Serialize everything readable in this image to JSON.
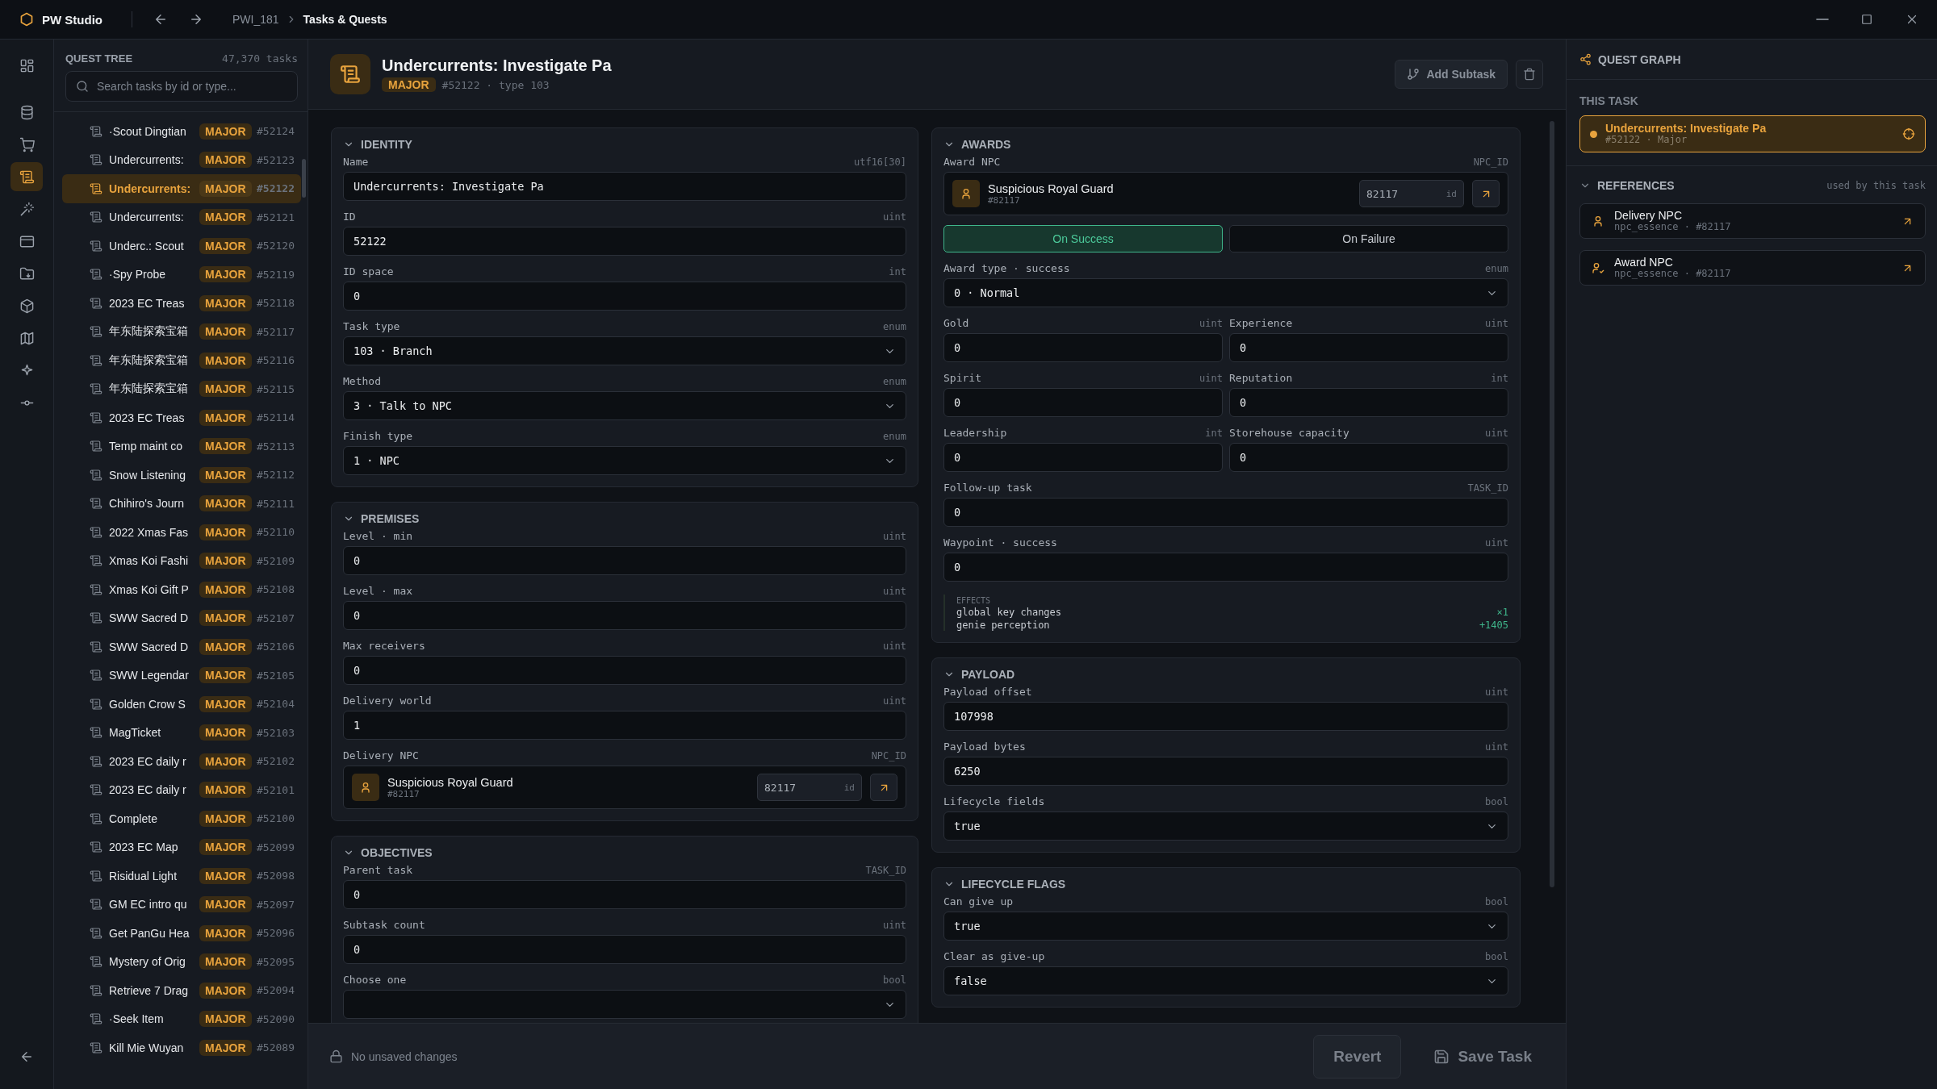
{
  "titlebar": {
    "app": "PW Studio",
    "breadcrumb": [
      "PWI_181",
      "Tasks & Quests"
    ]
  },
  "rail": {
    "items": [
      {
        "selected": false
      },
      {
        "selected": false
      },
      {
        "selected": false
      },
      {
        "selected": true
      },
      {
        "selected": false
      },
      {
        "selected": false
      },
      {
        "selected": false
      },
      {
        "selected": false
      },
      {
        "selected": false
      },
      {
        "selected": false
      },
      {
        "selected": false
      }
    ]
  },
  "tree": {
    "title": "QUEST TREE",
    "count": "47,370 tasks",
    "search": {
      "placeholder": "Search tasks by id or type..."
    },
    "rows": [
      {
        "name": "·Scout Dingtian",
        "badge": "MAJOR",
        "id": "#52124",
        "selected": false
      },
      {
        "name": "Undercurrents:",
        "badge": "MAJOR",
        "id": "#52123",
        "selected": false
      },
      {
        "name": "Undercurrents:",
        "badge": "MAJOR",
        "id": "#52122",
        "selected": true
      },
      {
        "name": "Undercurrents:",
        "badge": "MAJOR",
        "id": "#52121",
        "selected": false
      },
      {
        "name": "Underc.: Scout",
        "badge": "MAJOR",
        "id": "#52120",
        "selected": false
      },
      {
        "name": "·Spy Probe",
        "badge": "MAJOR",
        "id": "#52119",
        "selected": false
      },
      {
        "name": "2023 EC Treas",
        "badge": "MAJOR",
        "id": "#52118",
        "selected": false
      },
      {
        "name": "年东陆探索宝箱",
        "badge": "MAJOR",
        "id": "#52117",
        "selected": false
      },
      {
        "name": "年东陆探索宝箱",
        "badge": "MAJOR",
        "id": "#52116",
        "selected": false
      },
      {
        "name": "年东陆探索宝箱",
        "badge": "MAJOR",
        "id": "#52115",
        "selected": false
      },
      {
        "name": "2023 EC Treas",
        "badge": "MAJOR",
        "id": "#52114",
        "selected": false
      },
      {
        "name": "Temp maint co",
        "badge": "MAJOR",
        "id": "#52113",
        "selected": false
      },
      {
        "name": "Snow Listening",
        "badge": "MAJOR",
        "id": "#52112",
        "selected": false
      },
      {
        "name": "Chihiro's Journ",
        "badge": "MAJOR",
        "id": "#52111",
        "selected": false
      },
      {
        "name": "2022 Xmas Fas",
        "badge": "MAJOR",
        "id": "#52110",
        "selected": false
      },
      {
        "name": "Xmas Koi Fashi",
        "badge": "MAJOR",
        "id": "#52109",
        "selected": false
      },
      {
        "name": "Xmas Koi Gift P",
        "badge": "MAJOR",
        "id": "#52108",
        "selected": false
      },
      {
        "name": "SWW Sacred D",
        "badge": "MAJOR",
        "id": "#52107",
        "selected": false
      },
      {
        "name": "SWW Sacred D",
        "badge": "MAJOR",
        "id": "#52106",
        "selected": false
      },
      {
        "name": "SWW Legendar",
        "badge": "MAJOR",
        "id": "#52105",
        "selected": false
      },
      {
        "name": "Golden Crow S",
        "badge": "MAJOR",
        "id": "#52104",
        "selected": false
      },
      {
        "name": "MagTicket",
        "badge": "MAJOR",
        "id": "#52103",
        "selected": false
      },
      {
        "name": "2023 EC daily r",
        "badge": "MAJOR",
        "id": "#52102",
        "selected": false
      },
      {
        "name": "2023 EC daily r",
        "badge": "MAJOR",
        "id": "#52101",
        "selected": false
      },
      {
        "name": "Complete",
        "badge": "MAJOR",
        "id": "#52100",
        "selected": false
      },
      {
        "name": "2023 EC Map",
        "badge": "MAJOR",
        "id": "#52099",
        "selected": false
      },
      {
        "name": "Risidual Light",
        "badge": "MAJOR",
        "id": "#52098",
        "selected": false
      },
      {
        "name": "GM EC intro qu",
        "badge": "MAJOR",
        "id": "#52097",
        "selected": false
      },
      {
        "name": "Get PanGu Hea",
        "badge": "MAJOR",
        "id": "#52096",
        "selected": false
      },
      {
        "name": "Mystery of Orig",
        "badge": "MAJOR",
        "id": "#52095",
        "selected": false
      },
      {
        "name": "Retrieve 7 Drag",
        "badge": "MAJOR",
        "id": "#52094",
        "selected": false
      },
      {
        "name": "·Seek Item",
        "badge": "MAJOR",
        "id": "#52090",
        "selected": false
      },
      {
        "name": "Kill Mie Wuyan",
        "badge": "MAJOR",
        "id": "#52089",
        "selected": false
      }
    ]
  },
  "editor": {
    "header": {
      "title": "Undercurrents: Investigate Pa",
      "badge": "MAJOR",
      "meta": "#52122 · type 103",
      "action": "Add Subtask"
    },
    "columns": [
      {
        "sections": [
          {
            "title": "IDENTITY",
            "expanded": true,
            "fields": [
              {
                "kind": "text",
                "label": "Name",
                "type": "utf16[30]",
                "value": "Undercurrents: Investigate Pa"
              },
              {
                "kind": "text",
                "label": "ID",
                "type": "uint",
                "value": "52122"
              },
              {
                "kind": "text",
                "label": "ID space",
                "type": "int",
                "value": "0"
              },
              {
                "kind": "select",
                "label": "Task type",
                "type": "enum",
                "value": "103 · Branch"
              },
              {
                "kind": "select",
                "label": "Method",
                "type": "enum",
                "value": "3 · Talk to NPC"
              },
              {
                "kind": "select",
                "label": "Finish type",
                "type": "enum",
                "value": "1 · NPC"
              }
            ]
          },
          {
            "title": "PREMISES",
            "expanded": true,
            "fields": [
              {
                "kind": "text",
                "label": "Level · min",
                "type": "uint",
                "value": "0"
              },
              {
                "kind": "text",
                "label": "Level · max",
                "type": "uint",
                "value": "0"
              },
              {
                "kind": "text",
                "label": "Max receivers",
                "type": "uint",
                "value": "0"
              },
              {
                "kind": "text",
                "label": "Delivery world",
                "type": "uint",
                "value": "1"
              },
              {
                "kind": "npc",
                "label": "Delivery NPC",
                "type": "NPC_ID",
                "npc": "Suspicious Royal Guard",
                "npc_id": "#82117",
                "id_value": "82117",
                "id_hint": "id"
              }
            ]
          },
          {
            "title": "OBJECTIVES",
            "expanded": true,
            "fields": [
              {
                "kind": "text",
                "label": "Parent task",
                "type": "TASK_ID",
                "value": "0"
              },
              {
                "kind": "text",
                "label": "Subtask count",
                "type": "uint",
                "value": "0"
              },
              {
                "kind": "select",
                "label": "Choose one",
                "type": "bool"
              }
            ]
          }
        ]
      },
      {
        "sections": [
          {
            "title": "AWARDS",
            "expanded": true,
            "fields": [
              {
                "kind": "npc",
                "label": "Award NPC",
                "type": "NPC_ID",
                "npc": "Suspicious Royal Guard",
                "npc_id": "#82117",
                "id_value": "82117",
                "id_hint": "id"
              },
              {
                "kind": "tabs",
                "tabs": [
                  {
                    "label": "On Success",
                    "selected": true
                  },
                  {
                    "label": "On Failure",
                    "selected": false
                  }
                ]
              },
              {
                "kind": "select",
                "label": "Award type · success",
                "type": "enum",
                "value": "0 · Normal"
              },
              {
                "kind": "pair",
                "fields": [
                  {
                    "kind": "text",
                    "label": "Gold",
                    "type": "uint",
                    "value": "0"
                  },
                  {
                    "kind": "text",
                    "label": "Experience",
                    "type": "uint",
                    "value": "0"
                  }
                ]
              },
              {
                "kind": "pair",
                "fields": [
                  {
                    "kind": "text",
                    "label": "Spirit",
                    "type": "uint",
                    "value": "0"
                  },
                  {
                    "kind": "text",
                    "label": "Reputation",
                    "type": "int",
                    "value": "0"
                  }
                ]
              },
              {
                "kind": "pair",
                "fields": [
                  {
                    "kind": "text",
                    "label": "Leadership",
                    "type": "int",
                    "value": "0"
                  },
                  {
                    "kind": "text",
                    "label": "Storehouse capacity",
                    "type": "uint",
                    "value": "0"
                  }
                ]
              },
              {
                "kind": "text",
                "label": "Follow-up task",
                "type": "TASK_ID",
                "value": "0"
              },
              {
                "kind": "text",
                "label": "Waypoint · success",
                "type": "uint",
                "value": "0"
              },
              {
                "kind": "effects",
                "title": "EFFECTS",
                "items": [
                  {
                    "name": "global key changes",
                    "value": "×1"
                  },
                  {
                    "name": "genie perception",
                    "value": "+1405"
                  }
                ]
              }
            ]
          },
          {
            "title": "PAYLOAD",
            "expanded": true,
            "fields": [
              {
                "kind": "text",
                "label": "Payload offset",
                "type": "uint",
                "value": "107998"
              },
              {
                "kind": "text",
                "label": "Payload bytes",
                "type": "uint",
                "value": "6250"
              },
              {
                "kind": "select",
                "label": "Lifecycle fields",
                "type": "bool",
                "value": "true"
              }
            ]
          },
          {
            "title": "LIFECYCLE FLAGS",
            "expanded": true,
            "fields": [
              {
                "kind": "select",
                "label": "Can give up",
                "type": "bool",
                "value": "true"
              },
              {
                "kind": "select",
                "label": "Clear as give-up",
                "type": "bool",
                "value": "false"
              }
            ]
          }
        ]
      }
    ],
    "footer": {
      "status": "No unsaved changes",
      "buttons": [
        {
          "kind": "secondary",
          "label": "Revert",
          "disabled": true
        },
        {
          "kind": "primary",
          "label": "Save Task",
          "disabled": true
        }
      ]
    }
  },
  "graph": {
    "title": "QUEST GRAPH",
    "this_task": {
      "heading": "THIS TASK",
      "title": "Undercurrents: Investigate Pa",
      "meta": "#52122 · Major"
    },
    "references": {
      "title": "REFERENCES",
      "expanded": true,
      "note": "used by this task",
      "items": [
        {
          "kind": "delivery",
          "title": "Delivery NPC",
          "meta": "npc_essence · #82117"
        },
        {
          "kind": "award",
          "title": "Award NPC",
          "meta": "npc_essence · #82117"
        }
      ]
    }
  }
}
